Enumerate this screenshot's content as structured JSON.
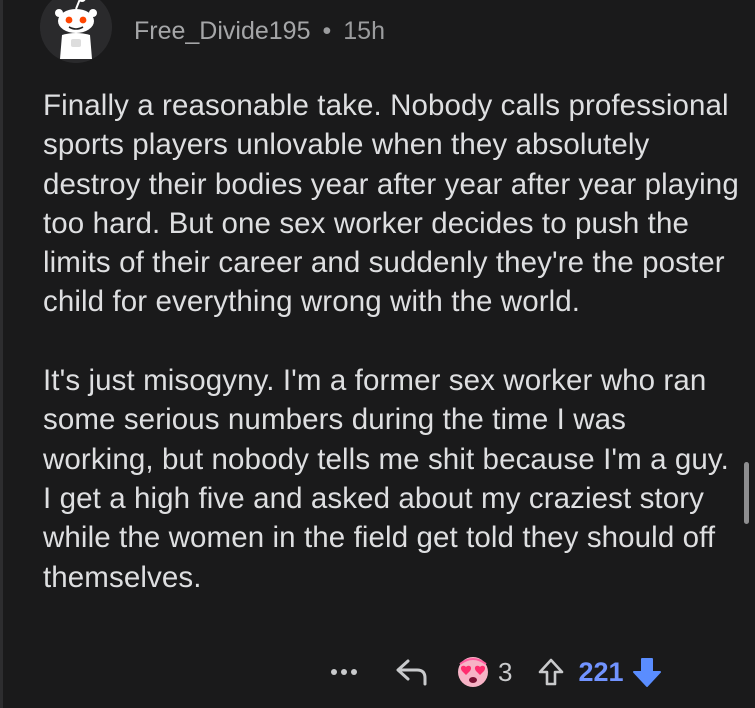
{
  "comment": {
    "author": "Free_Divide195",
    "separator": "•",
    "age": "15h",
    "paragraphs": [
      "Finally a reasonable take. Nobody calls professional sports players unlovable when they absolutely destroy their bodies year after year after year playing too hard. But one sex worker decides to push the limits of their career and suddenly they're the poster child for everything wrong with the world.",
      "It's just misogyny. I'm a former sex worker who ran some serious numbers during the time I was working, but nobody tells me shit because I'm a guy. I get a high five and asked about my craziest story while the women in the field get told they should off themselves."
    ]
  },
  "actions": {
    "more_icon": "ellipsis-icon",
    "reply_icon": "reply-arrow-icon",
    "award_icon": "heart-eyes-award-icon",
    "award_count": "3",
    "upvote_icon": "upvote-arrow-icon",
    "score": "221",
    "downvote_icon": "downvote-arrow-icon"
  },
  "colors": {
    "background": "#1a1a1b",
    "text": "#dedfe1",
    "meta": "#9b9c9e",
    "score_blue": "#7193ff",
    "downvote_active": "#5a8dff"
  }
}
